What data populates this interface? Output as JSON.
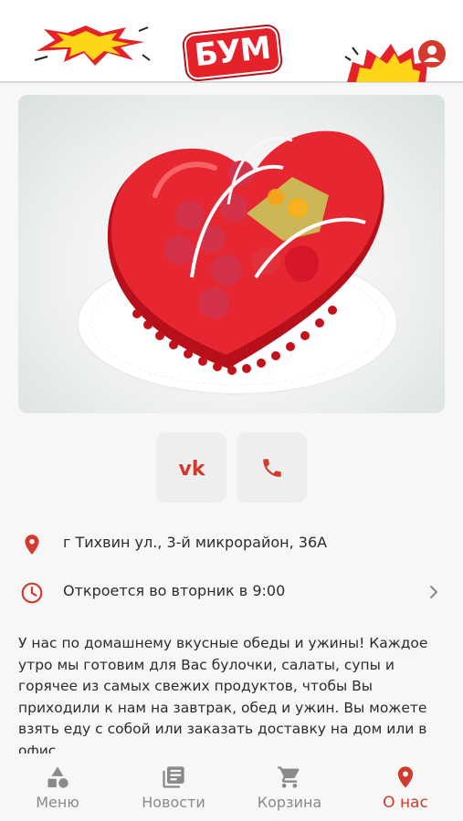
{
  "brand": {
    "logo_text": "БУМ",
    "accent": "#d23a2e"
  },
  "header": {
    "user_icon": "user-icon"
  },
  "hero": {
    "image_desc_icon": "cake-image"
  },
  "social": {
    "vk_icon": "vk-icon",
    "phone_icon": "phone-icon"
  },
  "info": {
    "address": "г Тихвин ул., 3-й микрорайон, 36А",
    "hours": "Откроется во вторник в 9:00"
  },
  "about": {
    "text": "У нас по домашнему вкусные обеды и ужины! Каждое утро мы готовим для Вас булочки, салаты, супы и горячее из самых свежих продуктов, чтобы Вы приходили к нам на завтрак, обед и ужин. Вы можете взять еду с собой или заказать доставку на дом или в офис"
  },
  "tabs": [
    {
      "label": "Меню",
      "icon": "shapes-icon"
    },
    {
      "label": "Новости",
      "icon": "news-icon"
    },
    {
      "label": "Корзина",
      "icon": "cart-icon"
    },
    {
      "label": "О нас",
      "icon": "location-pin-icon",
      "active": true
    }
  ]
}
